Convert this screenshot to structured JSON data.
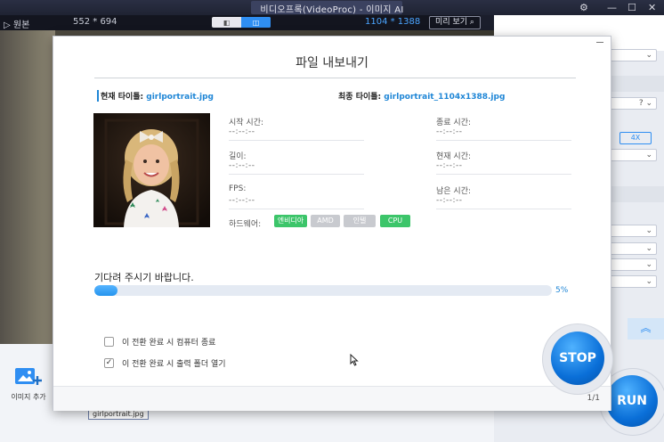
{
  "window": {
    "title": "비디오프록(VideoProc) - 이미지 AI"
  },
  "preview_toolbar": {
    "original_label": "원본",
    "left_dims": "552 * 694",
    "right_dims": "1104 * 1388",
    "preview_label": "미리 보기"
  },
  "left_strip": {
    "add_image_label": "이미지 추가",
    "file_tag": "girlportrait.jpg"
  },
  "settings_panel": {
    "scale_option": "4X",
    "help_glyph": "?"
  },
  "dialog": {
    "title": "파일 내보내기",
    "current_title_label": "현재 타이틀:",
    "current_title_value": "girlportrait.jpg",
    "final_title_label": "최종 타이틀:",
    "final_title_value": "girlportrait_1104x1388.jpg",
    "meta": {
      "start_time_label": "시작 시간:",
      "start_time_value": "--:--:--",
      "end_time_label": "종료 시간:",
      "end_time_value": "--:--:--",
      "length_label": "길이:",
      "length_value": "--:--:--",
      "current_time_label": "현재 시간:",
      "current_time_value": "--:--:--",
      "fps_label": "FPS:",
      "fps_value": "--:--:--",
      "remaining_time_label": "남은 시간:",
      "remaining_time_value": "--:--:--"
    },
    "hardware_label": "하드웨어:",
    "hardware": [
      {
        "label": "엔비디아",
        "active": true
      },
      {
        "label": "AMD",
        "active": false
      },
      {
        "label": "인텔",
        "active": false
      },
      {
        "label": "CPU",
        "active": true
      }
    ],
    "status_text": "기다려 주시기 바랍니다.",
    "progress_percent": 5,
    "progress_label": "5%",
    "options": [
      {
        "label": "이 전환 완료 시 컴퓨터 종료",
        "checked": false
      },
      {
        "label": "이 전환 완료 시 출력 폴더 열기",
        "checked": true
      }
    ],
    "page_indicator": "1/1",
    "stop_label": "STOP"
  },
  "run_label": "RUN",
  "colors": {
    "accent_blue": "#2f8ef2",
    "hardware_on": "#3cc56a",
    "hardware_off": "#c8cacf",
    "title_bar": "#2a2f44"
  }
}
